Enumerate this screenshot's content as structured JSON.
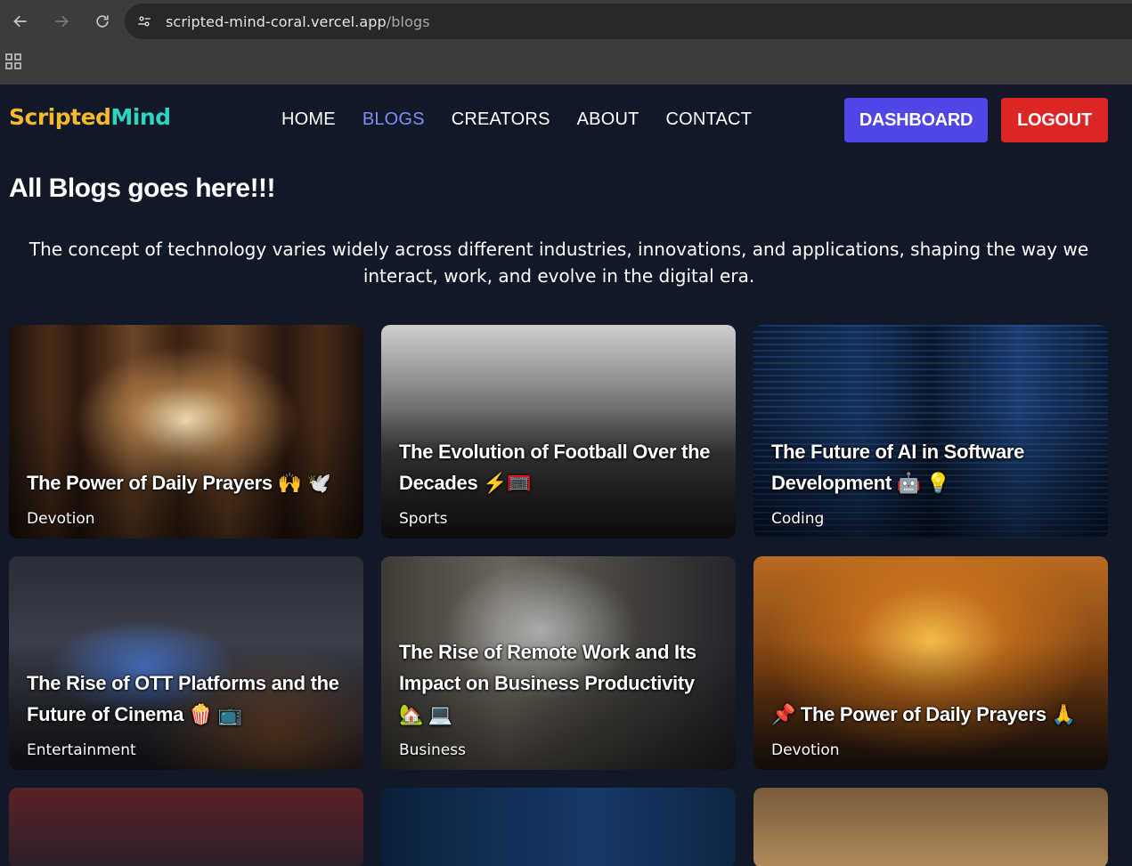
{
  "browser": {
    "url_host": "scripted-mind-coral.vercel.app",
    "url_path": "/blogs"
  },
  "site": {
    "logo_part1": "Scripted",
    "logo_part2": "Mind",
    "nav": [
      {
        "label": "HOME"
      },
      {
        "label": "BLOGS"
      },
      {
        "label": "CREATORS"
      },
      {
        "label": "ABOUT"
      },
      {
        "label": "CONTACT"
      }
    ],
    "dashboard_label": "DASHBOARD",
    "logout_label": "LOGOUT",
    "page_title": "All Blogs goes here!!!",
    "intro": "The concept of technology varies widely across different industries, innovations, and applications, shaping the way we interact, work, and evolve in the digital era.",
    "colors": {
      "background": "#111827",
      "accent_active": "#818cf8",
      "dashboard": "#4f46e5",
      "logout": "#dc2626",
      "logo_yellow": "#f5b82e",
      "logo_teal": "#2dd4bf"
    }
  },
  "cards": [
    {
      "title": "The Power of Daily Prayers 🙌 🕊️",
      "category": "Devotion"
    },
    {
      "title": "The Evolution of Football Over the Decades ⚡🥅",
      "category": "Sports"
    },
    {
      "title": "The Future of AI in Software Development 🤖 💡",
      "category": "Coding"
    },
    {
      "title": "The Rise of OTT Platforms and the Future of Cinema 🍿 📺",
      "category": "Entertainment"
    },
    {
      "title": "The Rise of Remote Work and Its Impact on Business Productivity 🏡 💻",
      "category": "Business"
    },
    {
      "title": "📌 The Power of Daily Prayers 🙏",
      "category": "Devotion"
    }
  ]
}
